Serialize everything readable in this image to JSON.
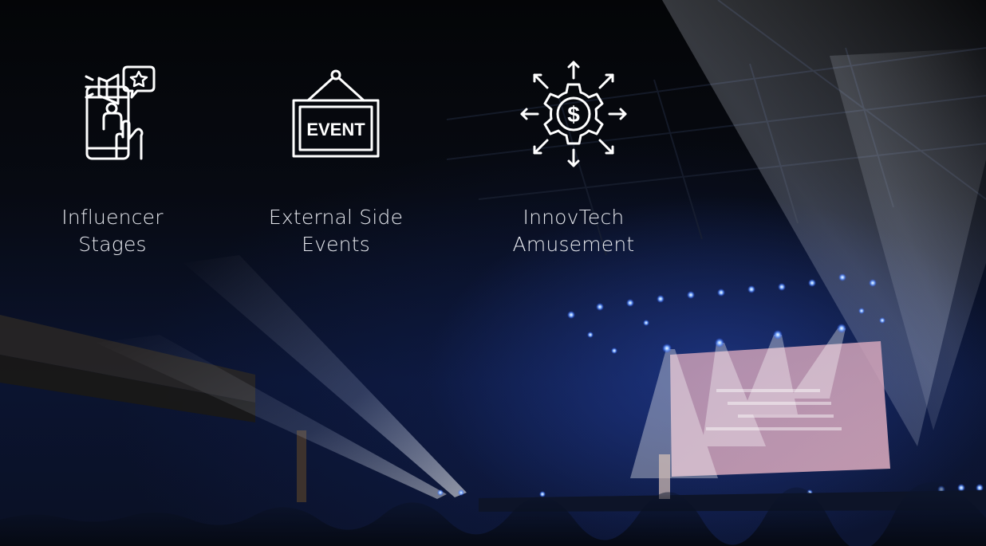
{
  "features": [
    {
      "icon": "influencer-phone-megaphone-icon",
      "line1": "Influencer",
      "line2": "Stages"
    },
    {
      "icon": "event-sign-icon",
      "icon_text": "EVENT",
      "line1": "External Side",
      "line2": "Events"
    },
    {
      "icon": "gear-dollar-arrows-icon",
      "icon_text": "$",
      "line1": "InnovTech",
      "line2": "Amusement"
    }
  ],
  "colors": {
    "icon_stroke": "#ffffff",
    "label_text": "#e6e8ee",
    "stage_light": "#1f48c8",
    "screen": "#d8a6b8"
  }
}
